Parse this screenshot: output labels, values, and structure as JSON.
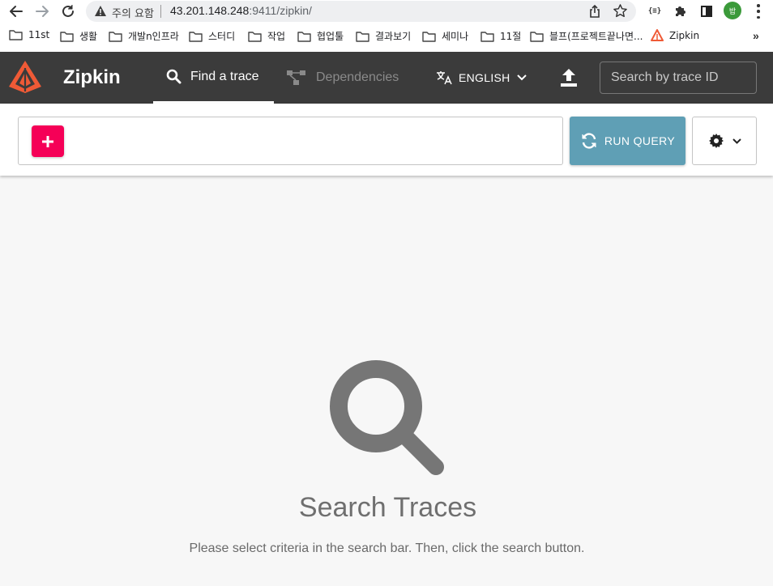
{
  "browser": {
    "omnibox": {
      "security_label": "주의 요함",
      "url_host": "43.201.148.248",
      "url_path": ":9411/zipkin/"
    },
    "avatar_initial": "밥",
    "extension_label": "{≡}",
    "bookmarks": [
      "11st",
      "생활",
      "개발n인프라",
      "스터디",
      "작업",
      "협업툴",
      "결과보기",
      "세미나",
      "11절",
      "블프(프로젝트끝나면...",
      "Zipkin"
    ],
    "bookmarks_more": "»"
  },
  "app": {
    "brand": "Zipkin",
    "nav": {
      "find_trace": "Find a trace",
      "dependencies": "Dependencies"
    },
    "language": "ENGLISH",
    "trace_search_placeholder": "Search by trace ID"
  },
  "query": {
    "run_label": "RUN QUERY"
  },
  "empty_state": {
    "title": "Search Traces",
    "description": "Please select criteria in the search bar. Then, click the search button."
  },
  "colors": {
    "header_bg": "#3b3b3b",
    "add_button": "#f50057",
    "run_button": "#5f9fb5",
    "logo": "#ef5a36"
  }
}
